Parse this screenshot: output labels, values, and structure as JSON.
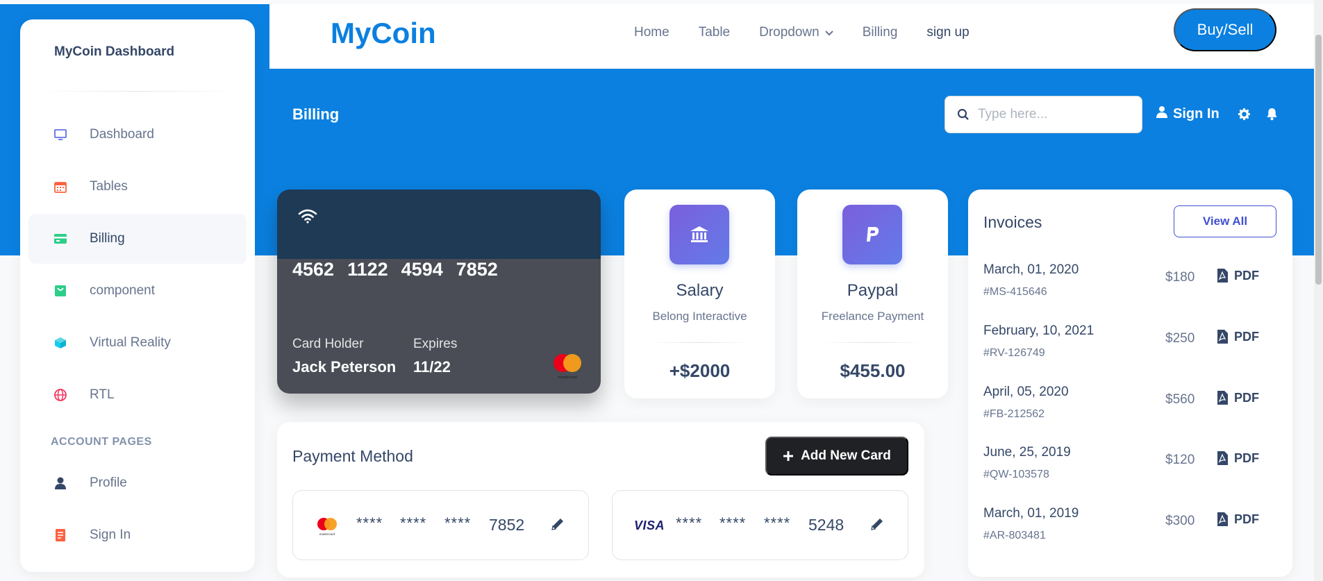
{
  "colors": {
    "primary": "#0b80e0",
    "text": "#344767",
    "muted": "#67748e",
    "indigo": "#3f4fd0"
  },
  "sidebar": {
    "brand": "MyCoin Dashboard",
    "items": [
      {
        "label": "Dashboard",
        "icon": "monitor-icon",
        "active": false
      },
      {
        "label": "Tables",
        "icon": "calendar-icon",
        "active": false
      },
      {
        "label": "Billing",
        "icon": "credit-card-icon",
        "active": true
      },
      {
        "label": "component",
        "icon": "basket-icon",
        "active": false
      },
      {
        "label": "Virtual Reality",
        "icon": "box-3d-icon",
        "active": false
      },
      {
        "label": "RTL",
        "icon": "globe-icon",
        "active": false
      }
    ],
    "section_title": "ACCOUNT PAGES",
    "account_items": [
      {
        "label": "Profile",
        "icon": "user-icon"
      },
      {
        "label": "Sign In",
        "icon": "document-icon"
      }
    ]
  },
  "topnav": {
    "logo": "MyCoin",
    "links": [
      "Home",
      "Table",
      "Dropdown",
      "Billing",
      "sign up"
    ],
    "cta": "Buy/Sell"
  },
  "header": {
    "title": "Billing",
    "search_placeholder": "Type here...",
    "signin": "Sign In"
  },
  "credit_card": {
    "number_groups": [
      "4562",
      "1122",
      "4594",
      "7852"
    ],
    "holder_label": "Card Holder",
    "holder_name": "Jack Peterson",
    "expires_label": "Expires",
    "expires_value": "11/22",
    "brand_logo_text": "mastercard"
  },
  "stats": [
    {
      "title": "Salary",
      "subtitle": "Belong Interactive",
      "value": "+$2000",
      "icon": "bank-icon"
    },
    {
      "title": "Paypal",
      "subtitle": "Freelance Payment",
      "value": "$455.00",
      "icon": "paypal-icon"
    }
  ],
  "invoices": {
    "title": "Invoices",
    "view_all": "View All",
    "pdf_label": "PDF",
    "rows": [
      {
        "date": "March, 01, 2020",
        "id": "#MS-415646",
        "amount": "$180"
      },
      {
        "date": "February, 10, 2021",
        "id": "#RV-126749",
        "amount": "$250"
      },
      {
        "date": "April, 05, 2020",
        "id": "#FB-212562",
        "amount": "$560"
      },
      {
        "date": "June, 25, 2019",
        "id": "#QW-103578",
        "amount": "$120"
      },
      {
        "date": "March, 01, 2019",
        "id": "#AR-803481",
        "amount": "$300"
      }
    ]
  },
  "payment": {
    "title": "Payment Method",
    "add_button": "Add New Card",
    "cards": [
      {
        "brand": "mastercard",
        "brand_text": "mastercard",
        "masked": [
          "****",
          "****",
          "****"
        ],
        "last4": "7852"
      },
      {
        "brand": "visa",
        "brand_text": "VISA",
        "masked": [
          "****",
          "****",
          "****"
        ],
        "last4": "5248"
      }
    ]
  }
}
